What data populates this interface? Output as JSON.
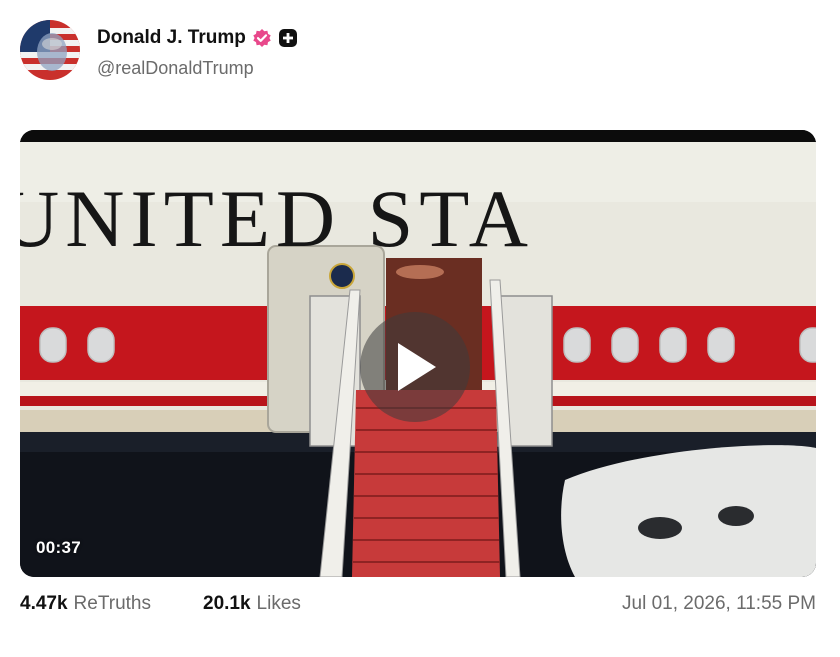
{
  "post": {
    "author_name": "Donald J. Trump",
    "handle": "@realDonaldTrump",
    "verified_icon": "verified-badge-icon",
    "plus_icon": "plus-icon",
    "video": {
      "duration": "00:37",
      "painted_text": "UNITED STA",
      "play_icon": "play-icon"
    },
    "retruths": {
      "count": "4.47k",
      "label": "ReTruths"
    },
    "likes": {
      "count": "20.1k",
      "label": "Likes"
    },
    "timestamp": "Jul 01, 2026, 11:55 PM"
  },
  "colors": {
    "verified": "#e8488b",
    "stripe_red": "#c5161d",
    "fuselage": "#e9e8df",
    "carpet": "#c73a3a",
    "text_secondary": "#6b6b6b"
  }
}
